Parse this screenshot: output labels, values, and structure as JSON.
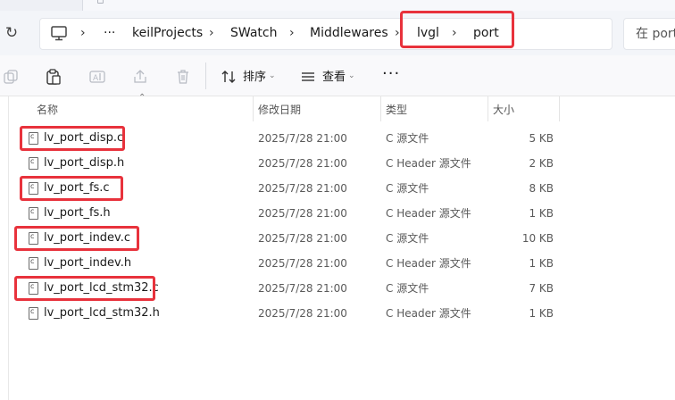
{
  "address": {
    "crumbs": [
      "keilProjects",
      "SWatch",
      "Middlewares",
      "lvgl",
      "port"
    ],
    "overflow": "···",
    "separator": "›"
  },
  "search": {
    "placeholder": "在 port"
  },
  "toolbar": {
    "sort_label": "排序",
    "view_label": "查看",
    "more_label": "···"
  },
  "columns": {
    "name": "名称",
    "date": "修改日期",
    "type": "类型",
    "size": "大小"
  },
  "files": [
    {
      "name": "lv_port_disp.c",
      "date": "2025/7/28 21:00",
      "type": "C 源文件",
      "size": "5 KB",
      "highlighted": true
    },
    {
      "name": "lv_port_disp.h",
      "date": "2025/7/28 21:00",
      "type": "C Header 源文件",
      "size": "2 KB",
      "highlighted": false
    },
    {
      "name": "lv_port_fs.c",
      "date": "2025/7/28 21:00",
      "type": "C 源文件",
      "size": "8 KB",
      "highlighted": true
    },
    {
      "name": "lv_port_fs.h",
      "date": "2025/7/28 21:00",
      "type": "C Header 源文件",
      "size": "1 KB",
      "highlighted": false
    },
    {
      "name": "lv_port_indev.c",
      "date": "2025/7/28 21:00",
      "type": "C 源文件",
      "size": "10 KB",
      "highlighted": true
    },
    {
      "name": "lv_port_indev.h",
      "date": "2025/7/28 21:00",
      "type": "C Header 源文件",
      "size": "1 KB",
      "highlighted": false
    },
    {
      "name": "lv_port_lcd_stm32.c",
      "date": "2025/7/28 21:00",
      "type": "C 源文件",
      "size": "7 KB",
      "highlighted": true
    },
    {
      "name": "lv_port_lcd_stm32.h",
      "date": "2025/7/28 21:00",
      "type": "C Header 源文件",
      "size": "1 KB",
      "highlighted": false
    }
  ],
  "colors": {
    "highlight": "#e8323c",
    "toolbar_bg": "#f9f9fb",
    "address_bg": "#f3f5f9"
  }
}
